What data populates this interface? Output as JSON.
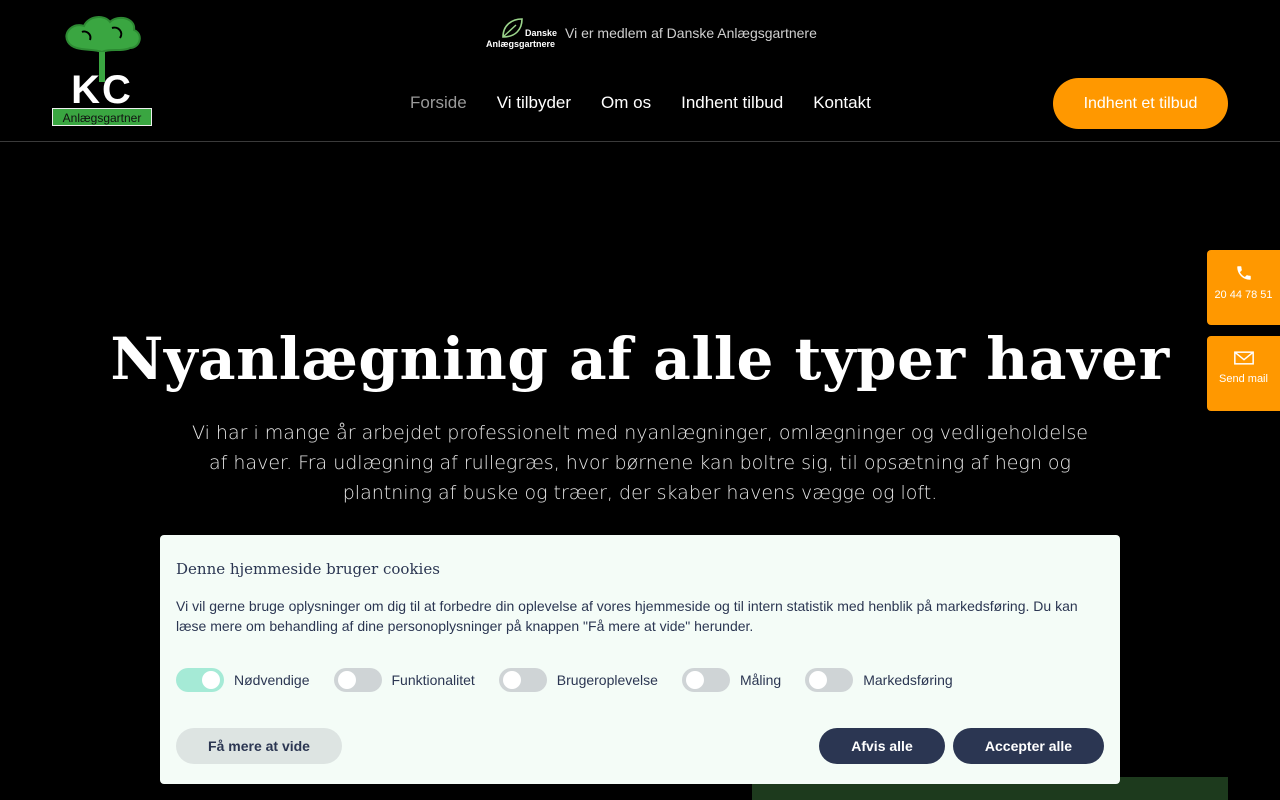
{
  "header": {
    "logo_letters": "KC",
    "logo_caption": "Anlægsgartner",
    "member_badge_line1": "Danske",
    "member_badge_line2": "Anlægsgartnere",
    "member_text": "Vi er medlem af Danske Anlægsgartnere",
    "nav": [
      {
        "label": "Forside",
        "active": true
      },
      {
        "label": "Vi tilbyder"
      },
      {
        "label": "Om os"
      },
      {
        "label": "Indhent tilbud"
      },
      {
        "label": "Kontakt"
      }
    ],
    "cta_label": "Indhent et tilbud"
  },
  "hero": {
    "title": "Nyanlægning af alle typer haver",
    "text": "Vi har i mange år arbejdet professionelt med nyanlægninger, omlægninger og vedligeholdelse af haver. Fra udlægning af rullegræs, hvor børnene kan boltre sig, til opsætning af hegn og plantning af buske og træer, der skaber havens vægge og loft."
  },
  "side": {
    "phone_label": "20 44 78 51",
    "mail_label": "Send mail"
  },
  "cookie": {
    "title": "Denne hjemmeside bruger cookies",
    "description": "Vi vil gerne bruge oplysninger om dig til at forbedre din oplevelse af vores hjemmeside og til intern statistik med henblik på markedsføring. Du kan læse mere om behandling af dine personoplysninger på knappen \"Få mere at vide\" herunder.",
    "toggles": [
      {
        "label": "Nødvendige",
        "on": true
      },
      {
        "label": "Funktionalitet",
        "on": false
      },
      {
        "label": "Brugeroplevelse",
        "on": false
      },
      {
        "label": "Måling",
        "on": false
      },
      {
        "label": "Markedsføring",
        "on": false
      }
    ],
    "more_label": "Få mere at vide",
    "reject_label": "Afvis alle",
    "accept_label": "Accepter alle"
  },
  "colors": {
    "accent": "#ff9800",
    "cookie_text": "#2b3652",
    "logo_green": "#3aa641"
  }
}
